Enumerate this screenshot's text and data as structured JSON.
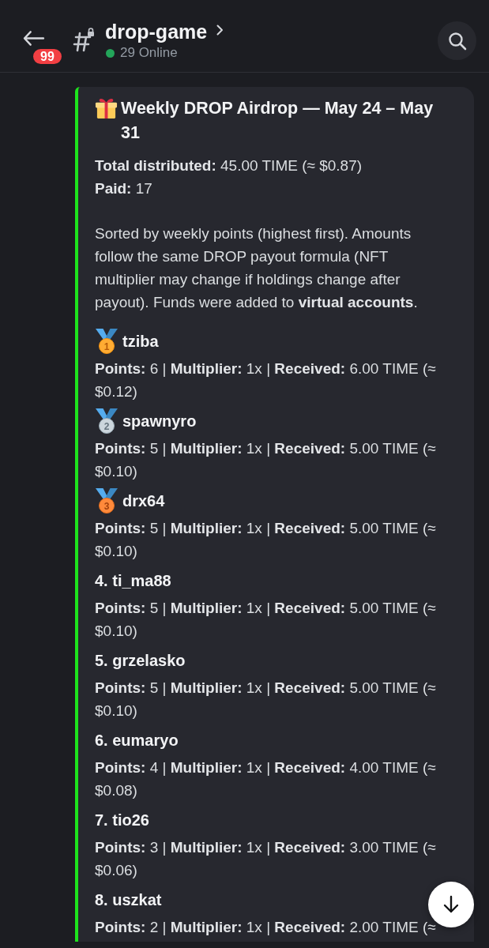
{
  "header": {
    "unread_badge": "99",
    "channel_name": "drop-game",
    "online_count": "29 Online"
  },
  "embed": {
    "title": "Weekly DROP Airdrop — May 24 – May 31",
    "summary": [
      "**Total distributed:** 45.00 TIME (≈ $0.87)",
      "**Paid:** 17"
    ],
    "description": "Sorted by weekly points (highest first). Amounts follow the same DROP payout formula (NFT multiplier may change if holdings change after payout). Funds were added to **virtual accounts**.",
    "entries": [
      {
        "kind": "gold",
        "rank": "1",
        "name": "tziba",
        "stats": "**Points:** 6 | **Multiplier:** 1x | **Received:** 6.00 TIME (≈ $0.12)"
      },
      {
        "kind": "silver",
        "rank": "2",
        "name": "spawnyro",
        "stats": "**Points:** 5 | **Multiplier:** 1x | **Received:** 5.00 TIME (≈ $0.10)"
      },
      {
        "kind": "bronze",
        "rank": "3",
        "name": "drx64",
        "stats": "**Points:** 5 | **Multiplier:** 1x | **Received:** 5.00 TIME (≈ $0.10)"
      },
      {
        "kind": "numbered",
        "name": "4. ti_ma88",
        "stats": "**Points:** 5 | **Multiplier:** 1x | **Received:** 5.00 TIME (≈ $0.10)"
      },
      {
        "kind": "numbered",
        "name": "5. grzelasko",
        "stats": "**Points:** 5 | **Multiplier:** 1x | **Received:** 5.00 TIME (≈ $0.10)"
      },
      {
        "kind": "numbered",
        "name": "6. eumaryo",
        "stats": "**Points:** 4 | **Multiplier:** 1x | **Received:** 4.00 TIME (≈ $0.08)"
      },
      {
        "kind": "numbered",
        "name": "7. tio26",
        "stats": "**Points:** 3 | **Multiplier:** 1x | **Received:** 3.00 TIME (≈ $0.06)"
      },
      {
        "kind": "numbered",
        "name": "8. uszkat",
        "stats": "**Points:** 2 | **Multiplier:** 1x | **Received:** 2.00 TIME (≈"
      }
    ]
  }
}
